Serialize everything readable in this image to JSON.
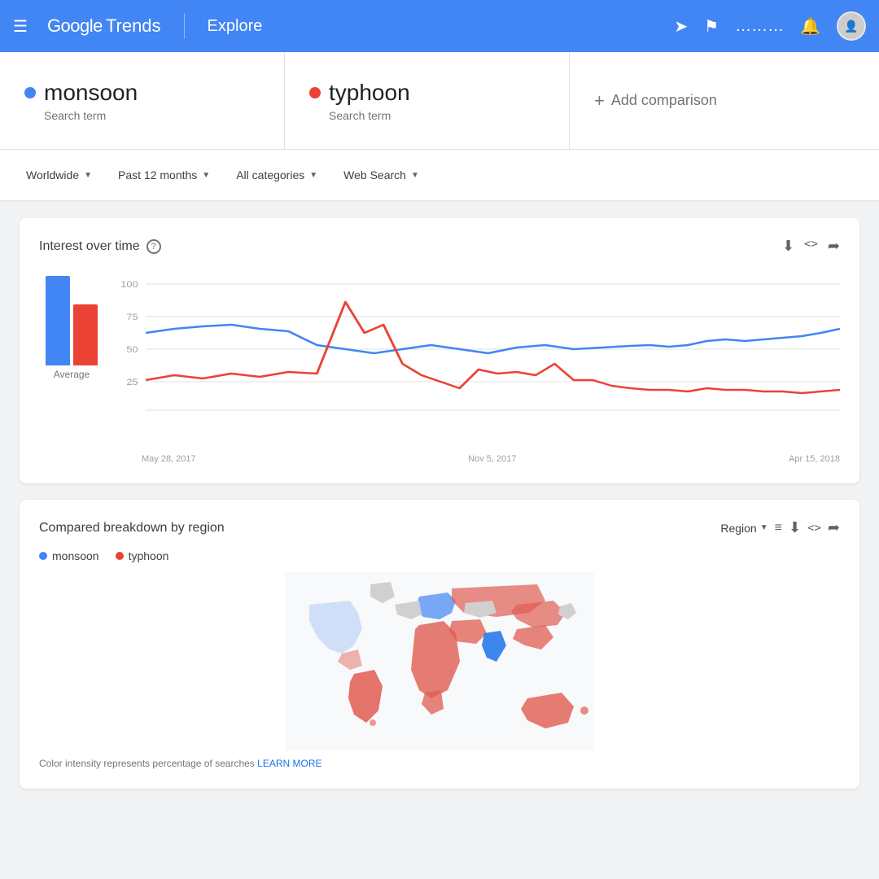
{
  "header": {
    "logo_google": "Google",
    "logo_trends": "Trends",
    "explore": "Explore",
    "menu_icon": "☰"
  },
  "search_terms": [
    {
      "name": "monsoon",
      "type": "Search term",
      "color": "#4285f4",
      "id": "monsoon"
    },
    {
      "name": "typhoon",
      "type": "Search term",
      "color": "#ea4335",
      "id": "typhoon"
    }
  ],
  "add_comparison": {
    "label": "Add comparison"
  },
  "filters": {
    "location": {
      "label": "Worldwide"
    },
    "time": {
      "label": "Past 12 months"
    },
    "category": {
      "label": "All categories"
    },
    "type": {
      "label": "Web Search"
    }
  },
  "interest_over_time": {
    "title": "Interest over time",
    "y_labels": [
      "100",
      "75",
      "50",
      "25"
    ],
    "x_labels": [
      "May 28, 2017",
      "Nov 5, 2017",
      "Apr 15, 2018"
    ],
    "average_label": "Average",
    "bar_blue_height": 110,
    "bar_red_height": 75
  },
  "breakdown": {
    "title": "Compared breakdown by region",
    "region_label": "Region",
    "legend": [
      {
        "term": "monsoon",
        "color": "#4285f4"
      },
      {
        "term": "typhoon",
        "color": "#ea4335"
      }
    ],
    "footer_text": "Color intensity represents percentage of searches ",
    "learn_more": "LEARN MORE"
  },
  "icons": {
    "download": "⬇",
    "embed": "<>",
    "share": "⤴",
    "help": "?",
    "list": "≡"
  }
}
